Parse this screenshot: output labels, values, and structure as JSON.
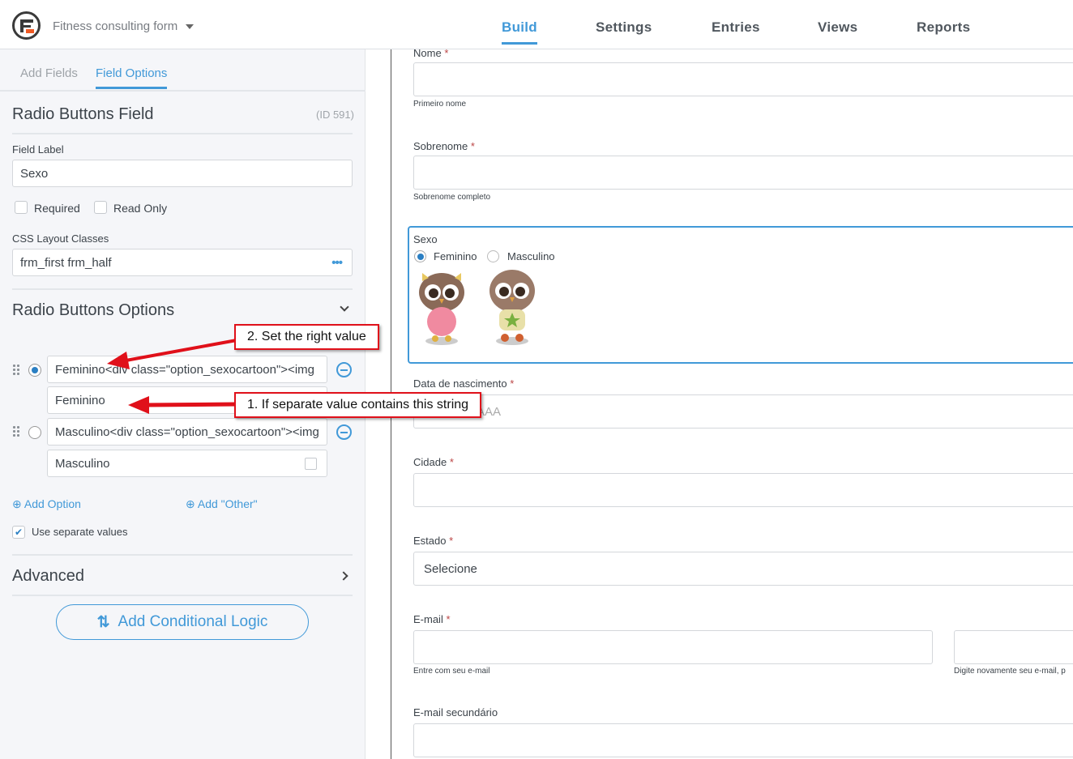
{
  "header": {
    "form_name": "Fitness consulting form",
    "tabs": [
      "Build",
      "Settings",
      "Entries",
      "Views",
      "Reports"
    ],
    "active_tab": "Build"
  },
  "sidebar": {
    "tabs": [
      "Add Fields",
      "Field Options"
    ],
    "field_title": "Radio Buttons Field",
    "field_id": "(ID 591)",
    "field_label_caption": "Field Label",
    "field_label_value": "Sexo",
    "required_label": "Required",
    "readonly_label": "Read Only",
    "css_caption": "CSS Layout Classes",
    "css_value": "frm_first frm_half",
    "options_title": "Radio Buttons Options",
    "options": [
      {
        "label": "Feminino<div class=\"option_sexocartoon\"><img",
        "value": "Feminino",
        "selected": true
      },
      {
        "label": "Masculino<div class=\"option_sexocartoon\"><img",
        "value": "Masculino",
        "selected": false
      }
    ],
    "add_option": "Add Option",
    "add_other": "Add \"Other\"",
    "separate_values_label": "Use separate values",
    "advanced_title": "Advanced",
    "conditional_logic": "Add Conditional Logic"
  },
  "callouts": {
    "c1": "1. If separate value contains this string",
    "c2": "2. Set the right value"
  },
  "form": {
    "nome": {
      "label": "Nome",
      "help": "Primeiro nome"
    },
    "sobrenome": {
      "label": "Sobrenome",
      "help": "Sobrenome completo"
    },
    "sexo": {
      "label": "Sexo",
      "options": [
        "Feminino",
        "Masculino"
      ]
    },
    "nascimento": {
      "label": "Data de nascimento",
      "placeholder": "DD/MM/AAAA"
    },
    "cidade": {
      "label": "Cidade"
    },
    "estado": {
      "label": "Estado",
      "value": "Selecione"
    },
    "email": {
      "label": "E-mail",
      "help": "Entre com seu e-mail",
      "confirm_help": "Digite novamente seu e-mail, p"
    },
    "email2": {
      "label": "E-mail secundário"
    },
    "required_mark": "*"
  }
}
